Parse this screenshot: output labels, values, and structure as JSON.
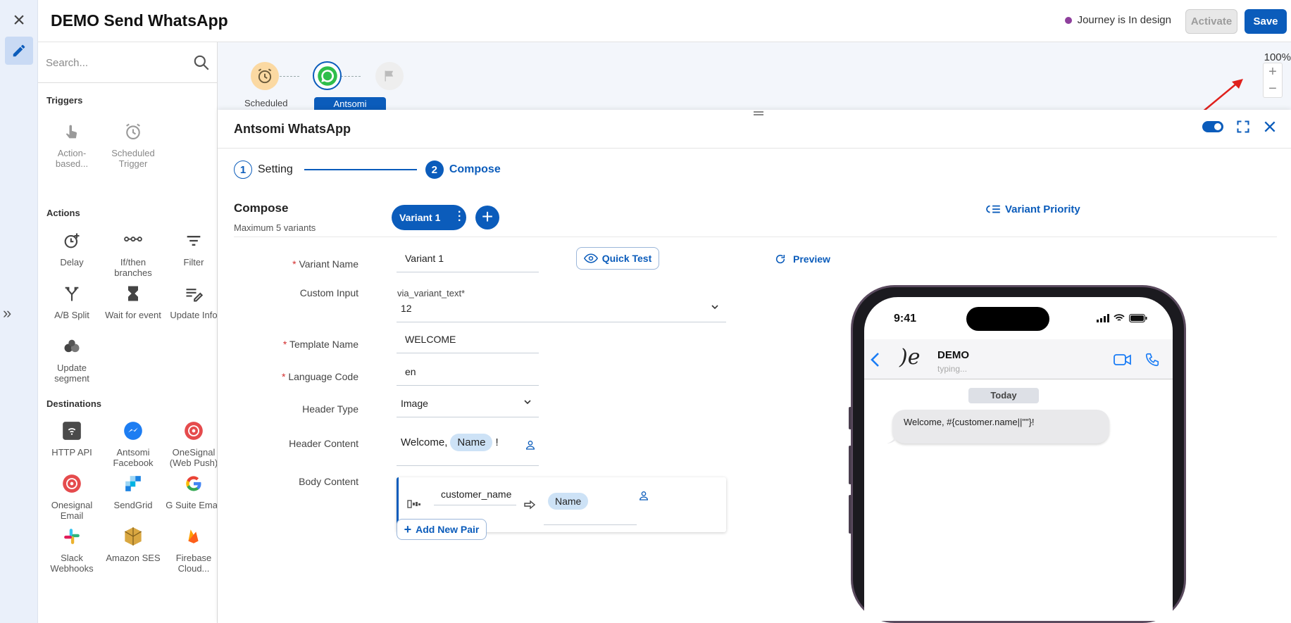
{
  "app": {
    "title": "DEMO Send WhatsApp",
    "status": "Journey is In design",
    "activate_label": "Activate",
    "save_label": "Save",
    "colors": {
      "primary": "#0b5cbb",
      "status_dot": "#8e3f9c",
      "annotation_arrow": "#e0201c"
    }
  },
  "sidebar": {
    "search_placeholder": "Search...",
    "sections": {
      "triggers": "Triggers",
      "actions": "Actions",
      "destinations": "Destinations"
    },
    "triggers": [
      {
        "label": "Action-based...",
        "icon": "touch-icon"
      },
      {
        "label": "Scheduled Trigger",
        "icon": "alarm-icon"
      }
    ],
    "actions": [
      {
        "label": "Delay",
        "icon": "delay-clock-icon"
      },
      {
        "label": "If/then branches",
        "icon": "branch-icon"
      },
      {
        "label": "Filter",
        "icon": "filter-icon"
      },
      {
        "label": "A/B Split",
        "icon": "split-icon"
      },
      {
        "label": "Wait for event",
        "icon": "hourglass-icon"
      },
      {
        "label": "Update Info",
        "icon": "edit-list-icon"
      },
      {
        "label": "Update segment",
        "icon": "segment-icon"
      }
    ],
    "destinations": [
      {
        "label": "HTTP API",
        "icon": "http-api-icon"
      },
      {
        "label": "Antsomi Facebook",
        "icon": "messenger-icon"
      },
      {
        "label": "OneSignal (Web Push)",
        "icon": "onesignal-icon"
      },
      {
        "label": "Onesignal Email",
        "icon": "onesignal-email-icon"
      },
      {
        "label": "SendGrid",
        "icon": "sendgrid-icon"
      },
      {
        "label": "G Suite Email",
        "icon": "google-icon"
      },
      {
        "label": "Slack Webhooks",
        "icon": "slack-icon"
      },
      {
        "label": "Amazon SES",
        "icon": "amazon-ses-icon"
      },
      {
        "label": "Firebase Cloud...",
        "icon": "firebase-icon"
      }
    ]
  },
  "canvas": {
    "nodes": [
      {
        "label": "Scheduled",
        "icon": "alarm-icon"
      },
      {
        "label": "Antsomi",
        "icon": "whatsapp-icon"
      },
      {
        "label": "",
        "icon": "flag-icon"
      }
    ],
    "zoom": "100%"
  },
  "panel": {
    "title": "Antsomi WhatsApp",
    "steps": [
      {
        "num": "1",
        "label": "Setting"
      },
      {
        "num": "2",
        "label": "Compose"
      }
    ],
    "compose_title": "Compose",
    "compose_sub": "Maximum 5 variants",
    "variant_pill": "Variant 1",
    "variant_priority": "Variant Priority",
    "quick_test": "Quick Test",
    "preview": "Preview",
    "fields": {
      "variant_name": {
        "label": "Variant Name",
        "value": "Variant 1"
      },
      "custom_input": {
        "label": "Custom Input",
        "sub": "via_variant_text*",
        "value": "12"
      },
      "template_name": {
        "label": "Template Name",
        "value": "WELCOME"
      },
      "language_code": {
        "label": "Language Code",
        "value": "en"
      },
      "header_type": {
        "label": "Header Type",
        "value": "Image"
      },
      "header_content": {
        "label": "Header Content",
        "prefix": "Welcome,",
        "tag": "Name",
        "suffix": "!"
      },
      "body_content": {
        "label": "Body Content",
        "key": "customer_name",
        "tag": "Name"
      }
    },
    "add_pair": "Add New Pair"
  },
  "phone": {
    "time": "9:41",
    "contact": "DEMO",
    "contact_status": "typing...",
    "logo_text": ")e",
    "date_chip": "Today",
    "message": "Welcome, #{customer.name||\"\"}!"
  }
}
